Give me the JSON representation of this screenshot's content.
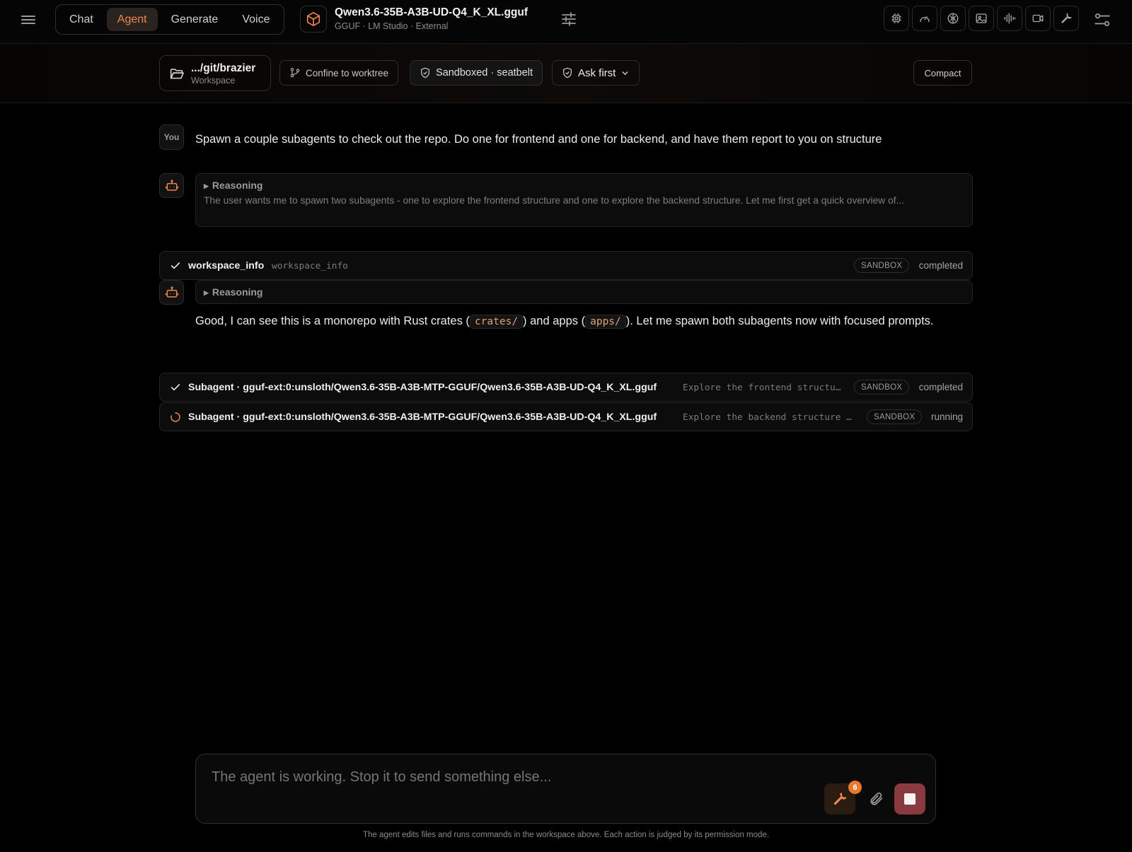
{
  "topbar": {
    "mode_tabs": [
      "Chat",
      "Agent",
      "Generate",
      "Voice"
    ],
    "active_tab": "Agent",
    "model": {
      "title": "Qwen3.6-35B-A3B-UD-Q4_K_XL.gguf",
      "subtitle": "GGUF · LM Studio · External"
    },
    "tool_icons": [
      "cpu-icon",
      "gauge-icon",
      "brain-icon",
      "image-icon",
      "waveform-icon",
      "video-icon",
      "wrench-icon"
    ]
  },
  "workspace": {
    "path": ".../git/brazier",
    "label": "Workspace",
    "confine_label": "Confine to worktree",
    "sandbox_label": "Sandboxed · seatbelt",
    "permission_label": "Ask first",
    "compact_label": "Compact"
  },
  "conversation": {
    "you_label": "You",
    "user_message": "Spawn a couple subagents to check out the repo. Do one for frontend and one for backend, and have them report to you on structure",
    "reasoning_1": {
      "header": "Reasoning",
      "text": "The user wants me to spawn two subagents - one to explore the frontend structure and one to explore the backend structure. Let me first get a quick overview of..."
    },
    "tool_1": {
      "name": "workspace_info",
      "arg": "workspace_info",
      "badge": "SANDBOX",
      "status": "completed"
    },
    "reasoning_2": {
      "header": "Reasoning"
    },
    "assistant": {
      "part1": "Good, I can see this is a monorepo with Rust crates (",
      "code1": "crates/",
      "part2": ") and apps (",
      "code2": "apps/",
      "part3": "). Let me spawn both subagents now with focused prompts."
    },
    "subagents": [
      {
        "name": "Subagent · gguf-ext:0:unsloth/Qwen3.6-35B-A3B-MTP-GGUF/Qwen3.6-35B-A3B-UD-Q4_K_XL.gguf",
        "arg": "Explore the frontend structu…",
        "badge": "SANDBOX",
        "status": "completed"
      },
      {
        "name": "Subagent · gguf-ext:0:unsloth/Qwen3.6-35B-A3B-MTP-GGUF/Qwen3.6-35B-A3B-UD-Q4_K_XL.gguf",
        "arg": "Explore the backend structure …",
        "badge": "SANDBOX",
        "status": "running"
      }
    ]
  },
  "composer": {
    "placeholder": "The agent is working. Stop it to send something else...",
    "tools_count": "6",
    "footer_note": "The agent edits files and runs commands in the workspace above. Each action is judged by its permission mode."
  },
  "colors": {
    "accent": "#f0874d",
    "stop": "#8a3a3e",
    "background": "#000000"
  }
}
